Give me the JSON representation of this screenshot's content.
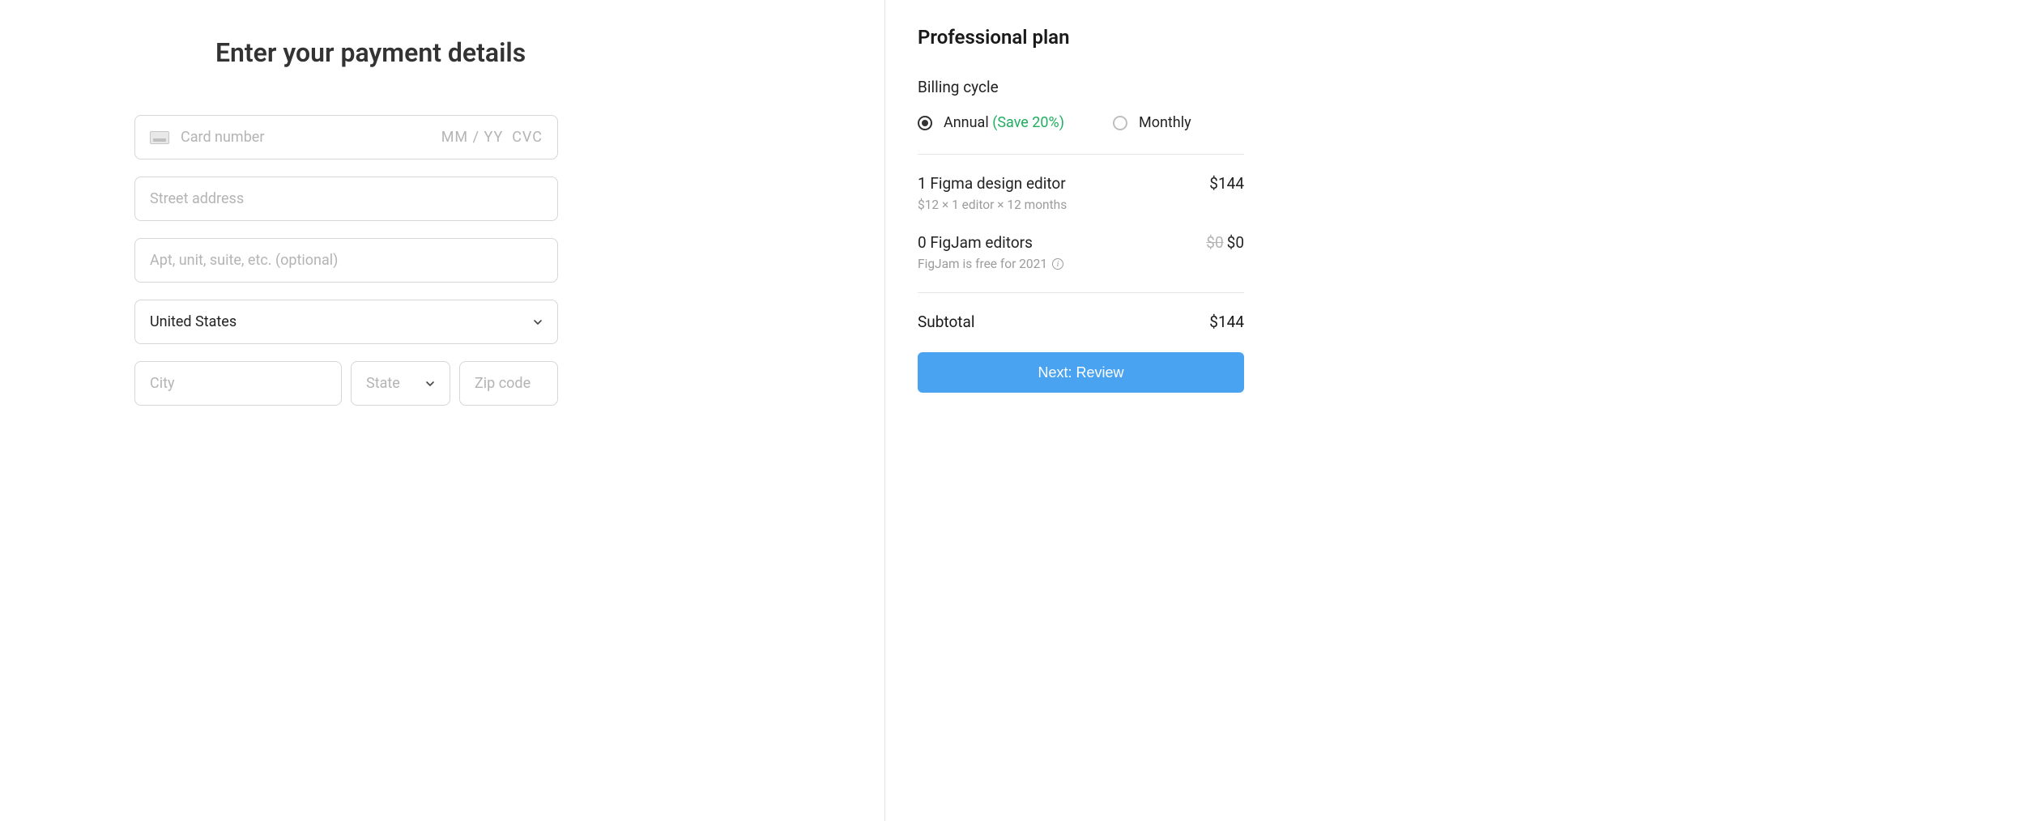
{
  "header": {
    "title": "Enter your payment details"
  },
  "form": {
    "card": {
      "placeholder": "Card number",
      "expiry_placeholder": "MM / YY",
      "cvc_placeholder": "CVC"
    },
    "address": {
      "placeholder": "Street address"
    },
    "apt": {
      "placeholder": "Apt, unit, suite, etc. (optional)"
    },
    "country": {
      "value": "United States"
    },
    "city": {
      "placeholder": "City"
    },
    "state": {
      "placeholder": "State"
    },
    "zip": {
      "placeholder": "Zip code"
    }
  },
  "summary": {
    "plan_title": "Professional plan",
    "billing_cycle_label": "Billing cycle",
    "options": {
      "annual": {
        "label": "Annual",
        "save_note": "(Save 20%)",
        "selected": true
      },
      "monthly": {
        "label": "Monthly",
        "selected": false
      }
    },
    "items": [
      {
        "name": "1 Figma design editor",
        "price": "$144",
        "sub": "$12 × 1 editor × 12 months"
      },
      {
        "name": "0 FigJam editors",
        "strike_price": "$0",
        "price": "$0",
        "sub": "FigJam is free for 2021"
      }
    ],
    "subtotal": {
      "label": "Subtotal",
      "value": "$144"
    },
    "cta_label": "Next: Review"
  }
}
